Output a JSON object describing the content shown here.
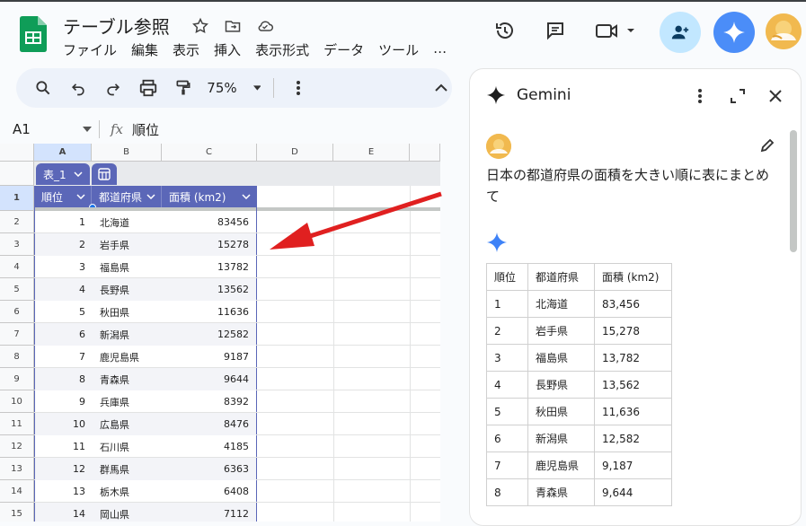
{
  "app": {
    "title": "テーブル参照",
    "menu": [
      "ファイル",
      "編集",
      "表示",
      "挿入",
      "表示形式",
      "データ",
      "ツール",
      "…"
    ]
  },
  "toolbar": {
    "zoom": "75%"
  },
  "formula": {
    "cell_ref": "A1",
    "fx_label": "fx",
    "content": "順位"
  },
  "grid": {
    "columns": [
      "A",
      "B",
      "C",
      "D",
      "E"
    ],
    "rows": [
      "1",
      "2",
      "3",
      "4",
      "5",
      "6",
      "7",
      "8",
      "9",
      "10",
      "11",
      "12",
      "13",
      "14",
      "15"
    ],
    "table_name": "表_1",
    "headers": [
      "順位",
      "都道府県",
      "面積 (km2)"
    ],
    "data": [
      [
        "1",
        "北海道",
        "83456"
      ],
      [
        "2",
        "岩手県",
        "15278"
      ],
      [
        "3",
        "福島県",
        "13782"
      ],
      [
        "4",
        "長野県",
        "13562"
      ],
      [
        "5",
        "秋田県",
        "11636"
      ],
      [
        "6",
        "新潟県",
        "12582"
      ],
      [
        "7",
        "鹿児島県",
        "9187"
      ],
      [
        "8",
        "青森県",
        "9644"
      ],
      [
        "9",
        "兵庫県",
        "8392"
      ],
      [
        "10",
        "広島県",
        "8476"
      ],
      [
        "11",
        "石川県",
        "4185"
      ],
      [
        "12",
        "群馬県",
        "6363"
      ],
      [
        "13",
        "栃木県",
        "6408"
      ],
      [
        "14",
        "岡山県",
        "7112"
      ]
    ]
  },
  "gemini": {
    "title": "Gemini",
    "prompt": "日本の都道府県の面積を大きい順に表にまとめて",
    "headers": [
      "順位",
      "都道府県",
      "面積 (km2)"
    ],
    "rows": [
      [
        "1",
        "北海道",
        "83,456"
      ],
      [
        "2",
        "岩手県",
        "15,278"
      ],
      [
        "3",
        "福島県",
        "13,782"
      ],
      [
        "4",
        "長野県",
        "13,562"
      ],
      [
        "5",
        "秋田県",
        "11,636"
      ],
      [
        "6",
        "新潟県",
        "12,582"
      ],
      [
        "7",
        "鹿児島県",
        "9,187"
      ],
      [
        "8",
        "青森県",
        "9,644"
      ]
    ]
  },
  "colors": {
    "table_header": "#5b67b8",
    "arrow": "#e02020",
    "gemini_button": "#4b8df8"
  }
}
